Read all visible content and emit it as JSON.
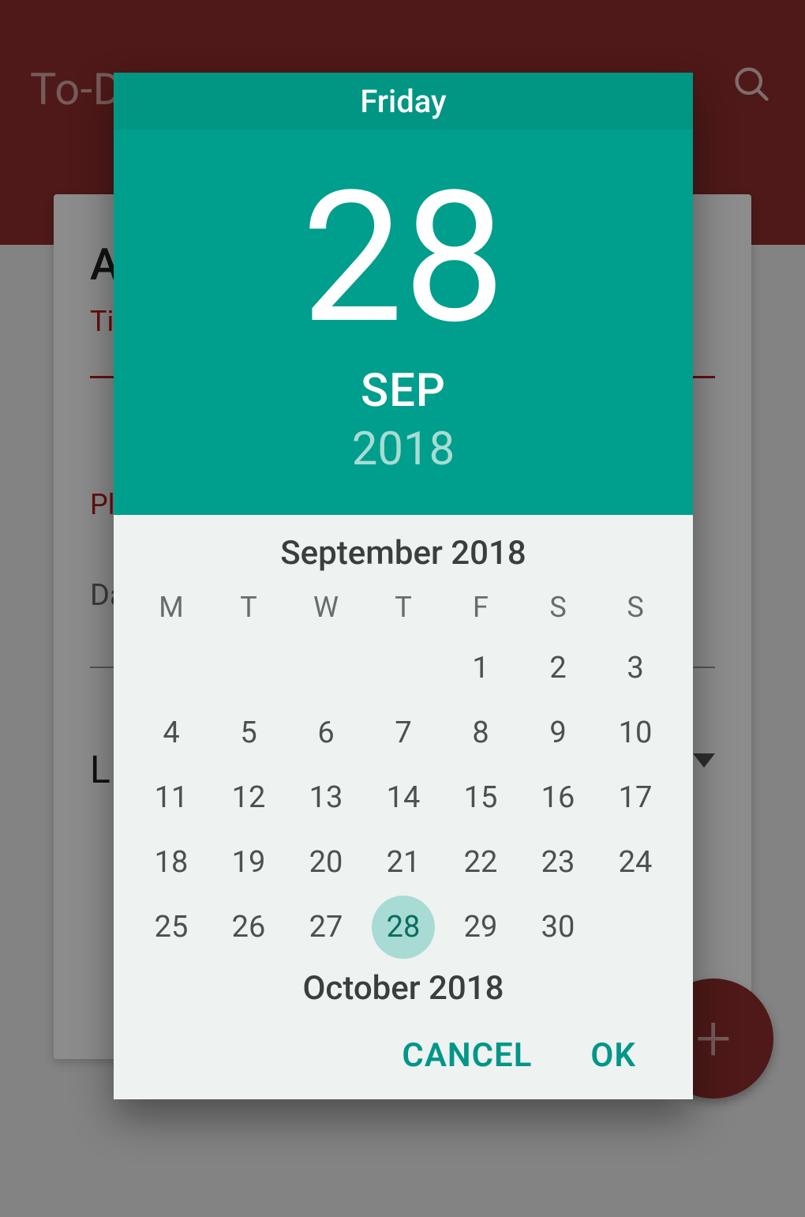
{
  "appbar": {
    "title": "To-D",
    "search_icon": "search"
  },
  "card": {
    "heading_fragment": "A",
    "title_label_fragment": "Ti",
    "place_label_fragment": "Pl",
    "date_label_fragment": "Da",
    "list_label_fragment": "L"
  },
  "fab": {
    "icon": "+"
  },
  "datepicker": {
    "weekday": "Friday",
    "day": "28",
    "month_abbr": "SEP",
    "year": "2018",
    "month_title": "September 2018",
    "next_month_title": "October 2018",
    "weekdays": [
      "M",
      "T",
      "W",
      "T",
      "F",
      "S",
      "S"
    ],
    "leading_blanks": 4,
    "days_in_month": 30,
    "selected_day": 28,
    "actions": {
      "cancel": "CANCEL",
      "ok": "OK"
    }
  },
  "colors": {
    "accent": "#009688",
    "header": "#009e8c",
    "header_strip": "#009683",
    "brand": "#8e2f2c"
  }
}
